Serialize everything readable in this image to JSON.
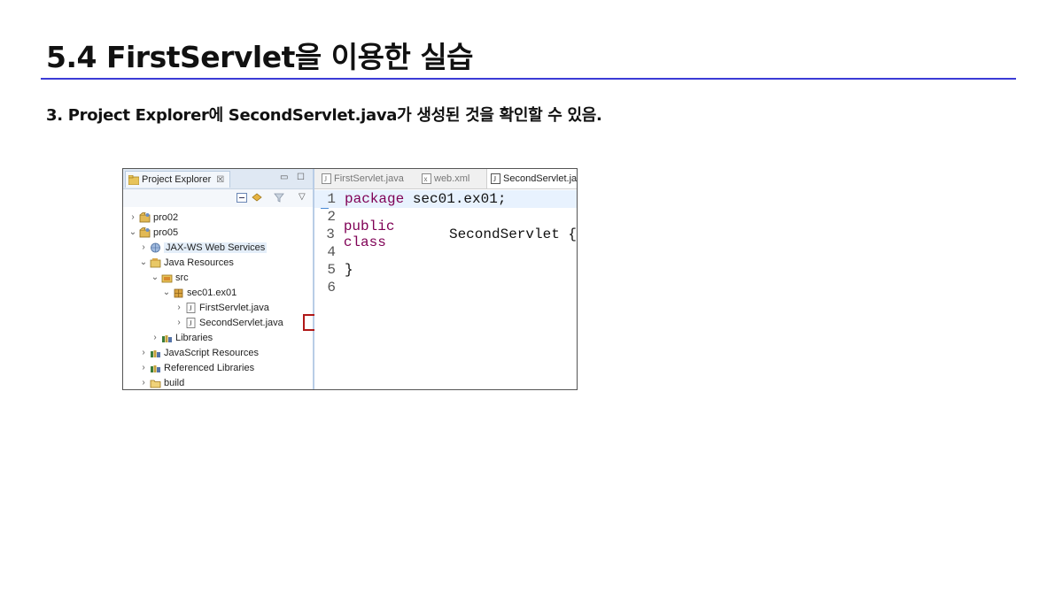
{
  "slide": {
    "title": "5.4 FirstServlet을 이용한 실습",
    "step": "3. Project Explorer에 SecondServlet.java가 생성된 것을 확인할 수 있음."
  },
  "explorer": {
    "tab_label": "Project Explorer",
    "close_glyph": "☒",
    "minimize_glyph": "▭",
    "maximize_glyph": "☐",
    "menu_glyph": "▽",
    "tree": [
      {
        "label": "pro02",
        "twisty": "›",
        "icon": "project-icon"
      },
      {
        "label": "pro05",
        "twisty": "⌄",
        "icon": "project-icon"
      },
      {
        "label": "JAX-WS Web Services",
        "twisty": "›",
        "icon": "webservice-icon"
      },
      {
        "label": "Java Resources",
        "twisty": "⌄",
        "icon": "resources-icon"
      },
      {
        "label": "src",
        "twisty": "⌄",
        "icon": "source-folder-icon"
      },
      {
        "label": "sec01.ex01",
        "twisty": "⌄",
        "icon": "package-icon"
      },
      {
        "label": "FirstServlet.java",
        "twisty": "›",
        "icon": "java-file-icon"
      },
      {
        "label": "SecondServlet.java",
        "twisty": "›",
        "icon": "java-file-icon"
      },
      {
        "label": "Libraries",
        "twisty": "›",
        "icon": "library-icon"
      },
      {
        "label": "JavaScript Resources",
        "twisty": "›",
        "icon": "library-icon"
      },
      {
        "label": "Referenced Libraries",
        "twisty": "›",
        "icon": "library-icon"
      },
      {
        "label": "build",
        "twisty": "›",
        "icon": "folder-icon"
      }
    ]
  },
  "editor": {
    "tabs": [
      "FirstServlet.java",
      "web.xml",
      "SecondServlet.java"
    ],
    "lines": [
      {
        "no": "1",
        "kw": "package",
        "rest": " sec01.ex01;"
      },
      {
        "no": "2",
        "kw": "",
        "rest": ""
      },
      {
        "no": "3",
        "kw": "public class",
        "rest": " SecondServlet {"
      },
      {
        "no": "4",
        "kw": "",
        "rest": ""
      },
      {
        "no": "5",
        "kw": "",
        "rest": "}"
      },
      {
        "no": "6",
        "kw": "",
        "rest": ""
      }
    ]
  },
  "colors": {
    "rule": "#3b3bd6",
    "keyword": "#7f0055",
    "highlight_box": "#b01818"
  }
}
